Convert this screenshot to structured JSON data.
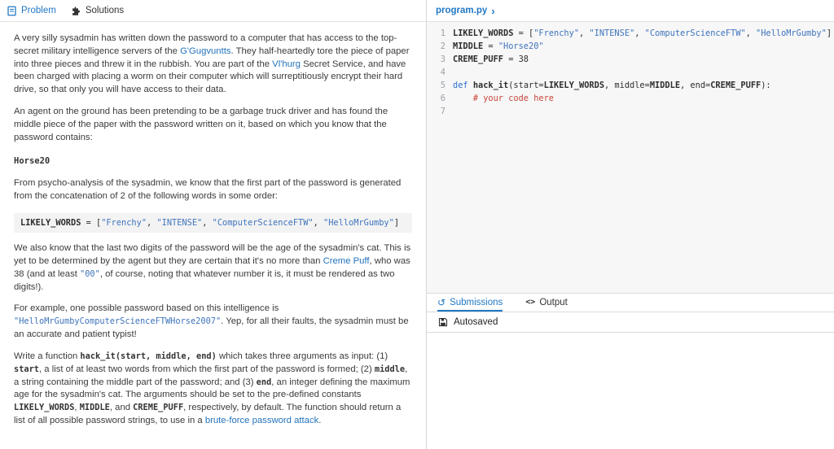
{
  "left": {
    "tabs": [
      {
        "label": "Problem",
        "active": true
      },
      {
        "label": "Solutions",
        "active": false
      }
    ],
    "blocks": [
      {
        "type": "paragraph",
        "segments": [
          {
            "t": "text",
            "v": "A very silly sysadmin has written down the password to a computer that has access to the top-secret military intelligence servers of the "
          },
          {
            "t": "link",
            "v": "G'Gugvuntts"
          },
          {
            "t": "text",
            "v": ". They half-heartedly tore the piece of paper into three pieces and threw it in the rubbish. You are part of the "
          },
          {
            "t": "link",
            "v": "Vl'hurg"
          },
          {
            "t": "text",
            "v": " Secret Service, and have been charged with placing a worm on their computer which will surreptitiously encrypt their hard drive, so that only you will have access to their data."
          }
        ]
      },
      {
        "type": "paragraph",
        "segments": [
          {
            "t": "text",
            "v": "An agent on the ground has been pretending to be a garbage truck driver and has found the middle piece of the paper with the password written on it, based on which you know that the password contains:"
          }
        ]
      },
      {
        "type": "codeline",
        "text": "Horse20"
      },
      {
        "type": "paragraph",
        "segments": [
          {
            "t": "text",
            "v": "From psycho-analysis of the sysadmin, we know that the first part of the password is generated from the concatenation of 2 of the following words in some order:"
          }
        ]
      },
      {
        "type": "codeblock",
        "segments": [
          {
            "t": "name",
            "v": "LIKELY_WORDS"
          },
          {
            "t": "plain",
            "v": " = ["
          },
          {
            "t": "string",
            "v": "\"Frenchy\""
          },
          {
            "t": "plain",
            "v": ", "
          },
          {
            "t": "string",
            "v": "\"INTENSE\""
          },
          {
            "t": "plain",
            "v": ", "
          },
          {
            "t": "string",
            "v": "\"ComputerScienceFTW\""
          },
          {
            "t": "plain",
            "v": ", "
          },
          {
            "t": "string",
            "v": "\"HelloMrGumby\""
          },
          {
            "t": "plain",
            "v": "]"
          }
        ]
      },
      {
        "type": "paragraph",
        "segments": [
          {
            "t": "text",
            "v": "We also know that the last two digits of the password will be the age of the sysadmin's cat. This is yet to be determined by the agent but they are certain that it's no more than "
          },
          {
            "t": "link",
            "v": "Creme Puff"
          },
          {
            "t": "text",
            "v": ", who was 38 (and at least "
          },
          {
            "t": "codestr",
            "v": "\"00\""
          },
          {
            "t": "text",
            "v": ", of course, noting that whatever number it is, it must be rendered as two digits!)."
          }
        ]
      },
      {
        "type": "paragraph",
        "segments": [
          {
            "t": "text",
            "v": "For example, one possible password based on this intelligence is "
          },
          {
            "t": "codestr",
            "v": "\"HelloMrGumbyComputerScienceFTWHorse2007\""
          },
          {
            "t": "text",
            "v": ". Yep, for all their faults, the sysadmin must be an accurate and patient typist!"
          }
        ]
      },
      {
        "type": "paragraph",
        "segments": [
          {
            "t": "text",
            "v": "Write a function "
          },
          {
            "t": "code",
            "v": "hack_it(start, middle, end)"
          },
          {
            "t": "text",
            "v": " which takes three arguments as input: (1) "
          },
          {
            "t": "code",
            "v": "start"
          },
          {
            "t": "text",
            "v": ", a list of at least two words from which the first part of the password is formed; (2) "
          },
          {
            "t": "code",
            "v": "middle"
          },
          {
            "t": "text",
            "v": ", a string containing the middle part of the password; and (3) "
          },
          {
            "t": "code",
            "v": "end"
          },
          {
            "t": "text",
            "v": ", an integer defining the maximum age for the sysadmin's cat. The arguments should be set to the pre-defined constants "
          },
          {
            "t": "code",
            "v": "LIKELY_WORDS"
          },
          {
            "t": "text",
            "v": ", "
          },
          {
            "t": "code",
            "v": "MIDDLE"
          },
          {
            "t": "text",
            "v": ", and "
          },
          {
            "t": "code",
            "v": "CREME_PUFF"
          },
          {
            "t": "text",
            "v": ", respectively, by default. The function should return a list of all possible password strings, to use in a "
          },
          {
            "t": "link",
            "v": "brute-force password attack"
          },
          {
            "t": "text",
            "v": "."
          }
        ]
      }
    ]
  },
  "editor": {
    "filename": "program.py",
    "lines": [
      {
        "no": "1",
        "segments": [
          {
            "t": "name",
            "v": "LIKELY_WORDS"
          },
          {
            "t": "plain",
            "v": " = ["
          },
          {
            "t": "string",
            "v": "\"Frenchy\""
          },
          {
            "t": "plain",
            "v": ", "
          },
          {
            "t": "string",
            "v": "\"INTENSE\""
          },
          {
            "t": "plain",
            "v": ", "
          },
          {
            "t": "string",
            "v": "\"ComputerScienceFTW\""
          },
          {
            "t": "plain",
            "v": ", "
          },
          {
            "t": "string",
            "v": "\"HelloMrGumby\""
          },
          {
            "t": "plain",
            "v": "]"
          }
        ]
      },
      {
        "no": "2",
        "segments": [
          {
            "t": "name",
            "v": "MIDDLE"
          },
          {
            "t": "plain",
            "v": " = "
          },
          {
            "t": "string",
            "v": "\"Horse20\""
          }
        ]
      },
      {
        "no": "3",
        "segments": [
          {
            "t": "name",
            "v": "CREME_PUFF"
          },
          {
            "t": "plain",
            "v": " = "
          },
          {
            "t": "number",
            "v": "38"
          }
        ]
      },
      {
        "no": "4",
        "segments": []
      },
      {
        "no": "5",
        "segments": [
          {
            "t": "keyword",
            "v": "def "
          },
          {
            "t": "func",
            "v": "hack_it"
          },
          {
            "t": "plain",
            "v": "(start="
          },
          {
            "t": "name",
            "v": "LIKELY_WORDS"
          },
          {
            "t": "plain",
            "v": ", middle="
          },
          {
            "t": "name",
            "v": "MIDDLE"
          },
          {
            "t": "plain",
            "v": ", end="
          },
          {
            "t": "name",
            "v": "CREME_PUFF"
          },
          {
            "t": "plain",
            "v": "):"
          }
        ]
      },
      {
        "no": "6",
        "segments": [
          {
            "t": "comment",
            "v": "    # your code here"
          }
        ]
      },
      {
        "no": "7",
        "segments": []
      }
    ]
  },
  "bottom": {
    "tabs": [
      {
        "label": "Submissions",
        "active": true
      },
      {
        "label": "Output",
        "active": false
      }
    ],
    "autosaved": "Autosaved"
  },
  "icons": {
    "chevron_glyph": "›",
    "history_glyph": "↺",
    "code_glyph": "<>"
  },
  "colors": {
    "accent_blue": "#2178c4",
    "link_blue": "#2373bd",
    "string_blue": "#3f74bc",
    "comment_red": "#c7483a",
    "editor_bg": "#f7f7f7",
    "codeblock_bg": "#f3f3f3"
  }
}
